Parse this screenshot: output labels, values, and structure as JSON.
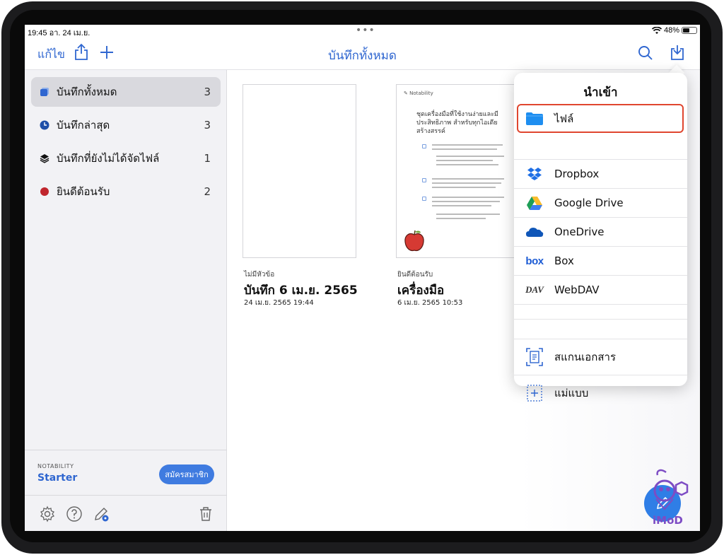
{
  "status_bar": {
    "time": "19:45",
    "date": "อา. 24 เม.ย.",
    "battery": "48%",
    "battery_level": 0.48
  },
  "nav": {
    "edit_label": "แก้ไข",
    "title": "บันทึกทั้งหมด"
  },
  "sidebar": {
    "items": [
      {
        "label": "บันทึกทั้งหมด",
        "count": "3",
        "icon": "stack-icon",
        "color": "#2f66d0"
      },
      {
        "label": "บันทึกล่าสุด",
        "count": "3",
        "icon": "clock-icon",
        "color": "#1f4fa8"
      },
      {
        "label": "บันทึกที่ยังไม่ได้จัดไฟล์",
        "count": "1",
        "icon": "layers-icon",
        "color": "#111111"
      },
      {
        "label": "ยินดีต้อนรับ",
        "count": "2",
        "icon": "red-dot-icon",
        "color": "#c0262d"
      }
    ],
    "plan_kicker": "NOTABILITY",
    "plan_name": "Starter",
    "subscribe_label": "สมัครสมาชิก"
  },
  "notes": [
    {
      "subject": "ไม่มีหัวข้อ",
      "title": "บันทึก 6 เม.ย. 2565",
      "date": "24 เม.ย. 2565 19:44"
    },
    {
      "subject": "ยินดีต้อนรับ",
      "title": "เครื่องมือ",
      "date": "6 เม.ย. 2565 10:53",
      "thumbnail": {
        "logo": "Notability",
        "heading": "ชุดเครื่องมือที่ใช้งานง่ายและมีประสิทธิภาพ สำหรับทุกไอเดียสร้างสรรค์"
      }
    }
  ],
  "import_menu": {
    "title": "นำเข้า",
    "items": [
      {
        "label": "ไฟล์",
        "icon": "folder-icon",
        "highlighted": true
      },
      {
        "label": "Dropbox",
        "icon": "dropbox-icon"
      },
      {
        "label": "Google Drive",
        "icon": "google-drive-icon"
      },
      {
        "label": "OneDrive",
        "icon": "onedrive-icon"
      },
      {
        "label": "Box",
        "icon": "box-icon"
      },
      {
        "label": "WebDAV",
        "icon": "webdav-icon"
      }
    ],
    "extra_items": [
      {
        "label": "สแกนเอกสาร",
        "icon": "scan-document-icon"
      },
      {
        "label": "แม่แบบ",
        "icon": "template-icon"
      }
    ]
  },
  "watermark": "iMoD",
  "colors": {
    "accent": "#2f66d0",
    "highlight_border": "#e0462f",
    "fab": "#2f7ee6"
  }
}
